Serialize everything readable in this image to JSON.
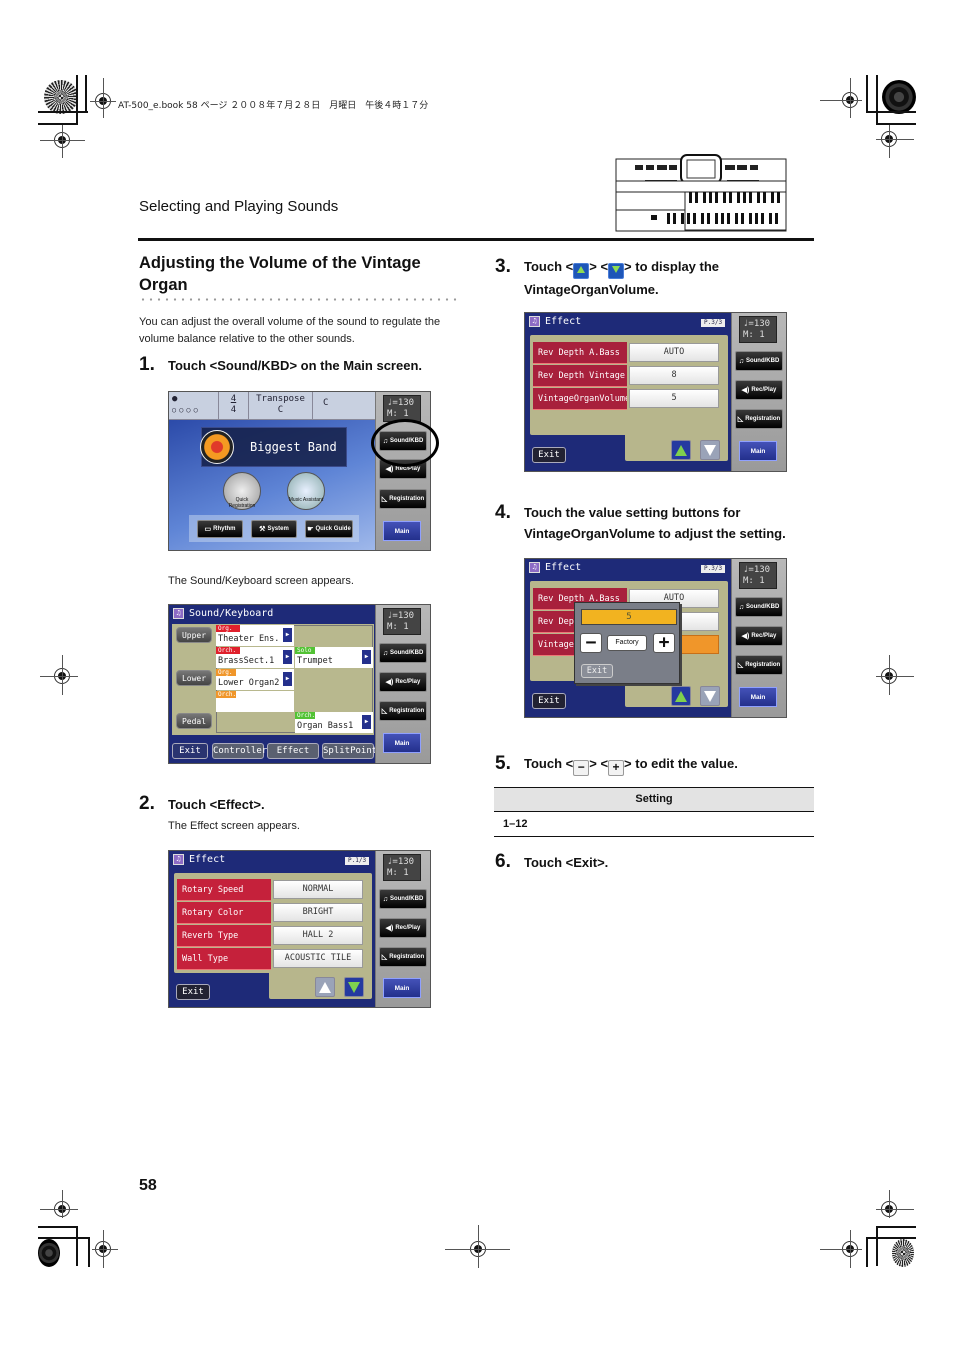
{
  "print_marks": {
    "book_line": "AT-500_e.book  58 ページ  ２００８年７月２８日　月曜日　午後４時１７分"
  },
  "header": {
    "section_title": "Selecting and Playing Sounds",
    "illustration": "organ-panel-illustration"
  },
  "section": {
    "heading": "Adjusting the Volume of the Vintage Organ",
    "intro": "You can adjust the overall volume of the sound to regulate the volume balance relative to the other sounds."
  },
  "steps": [
    {
      "num": "1.",
      "text": "Touch <Sound/KBD> on the Main screen.",
      "caption": "The Sound/Keyboard screen appears."
    },
    {
      "num": "2.",
      "text": "Touch <Effect>.",
      "caption": "The Effect screen appears."
    },
    {
      "num": "3.",
      "text_pre": "Touch <",
      "text_mid": "> <",
      "text_post": "> to display the VintageOrganVolume."
    },
    {
      "num": "4.",
      "text": "Touch the value setting buttons for VintageOrganVolume to adjust the setting."
    },
    {
      "num": "5.",
      "text_pre": "Touch <",
      "text_mid": "> <",
      "text_post": "> to edit the value.",
      "minus": "−",
      "plus": "+"
    },
    {
      "num": "6.",
      "text": "Touch <Exit>."
    }
  ],
  "setting_table": {
    "header": "Setting",
    "value": "1–12"
  },
  "side_panel": {
    "tempo": "♩=130",
    "measure": "M:   1",
    "sound_kbd": "Sound/KBD",
    "rec_play": "Rec/Play",
    "registration": "Registration",
    "main": "Main"
  },
  "main_screen": {
    "beat_top": "4",
    "beat_bottom": "4",
    "transpose_label": "Transpose",
    "transpose_value": "C",
    "key": "C",
    "song": "Biggest Band",
    "quick_registration": "Quick Registration",
    "music_assistant": "Music Assistant",
    "rhythm": "Rhythm",
    "system": "System",
    "quick_guide": "Quick Guide"
  },
  "sound_keyboard_screen": {
    "title": "Sound/Keyboard",
    "parts": [
      "Upper",
      "Lower",
      "Pedal"
    ],
    "slots": [
      {
        "tag": "Org.",
        "tag_color": "#e0202c",
        "name": "Theater Ens."
      },
      {
        "tag": "Orch.",
        "tag_color": "#e0202c",
        "name": "BrassSect.1"
      },
      {
        "tag": "Solo",
        "tag_color": "#52c234",
        "name": "Trumpet"
      },
      {
        "tag": "Org.",
        "tag_color": "#f0962a",
        "name": "Lower Organ2"
      },
      {
        "tag": "Orch.",
        "tag_color": "#f0962a",
        "name": ""
      },
      {
        "tag": "Orch.",
        "tag_color": "#52c234",
        "name": "Organ Bass1"
      }
    ],
    "tabs": [
      "Exit",
      "Controller",
      "Effect",
      "SplitPoint"
    ]
  },
  "effect_p1": {
    "title": "Effect",
    "page": "P.1/3",
    "rows": [
      {
        "label": "Rotary Speed",
        "value": "NORMAL"
      },
      {
        "label": "Rotary Color",
        "value": "BRIGHT"
      },
      {
        "label": "Reverb Type",
        "value": "HALL 2"
      },
      {
        "label": "Wall Type",
        "value": "ACOUSTIC TILE"
      }
    ],
    "exit": "Exit"
  },
  "effect_p3": {
    "title": "Effect",
    "page": "P.3/3",
    "rows": [
      {
        "label": "Rev Depth A.Bass",
        "value": "AUTO"
      },
      {
        "label": "Rev Depth Vintage",
        "value": "8"
      },
      {
        "label": "VintageOrganVolume",
        "value": "5"
      }
    ],
    "exit": "Exit"
  },
  "effect_p3_popup": {
    "row_labels_partial": [
      "Rev Depth A.Bass",
      "Rev Dep",
      "Vintage"
    ],
    "row_value_visible": "AUTO",
    "popup_value": "5",
    "minus": "−",
    "factory": "Factory",
    "plus": "+",
    "popup_exit": "Exit",
    "exit": "Exit"
  },
  "footer": {
    "page_number": "58"
  }
}
